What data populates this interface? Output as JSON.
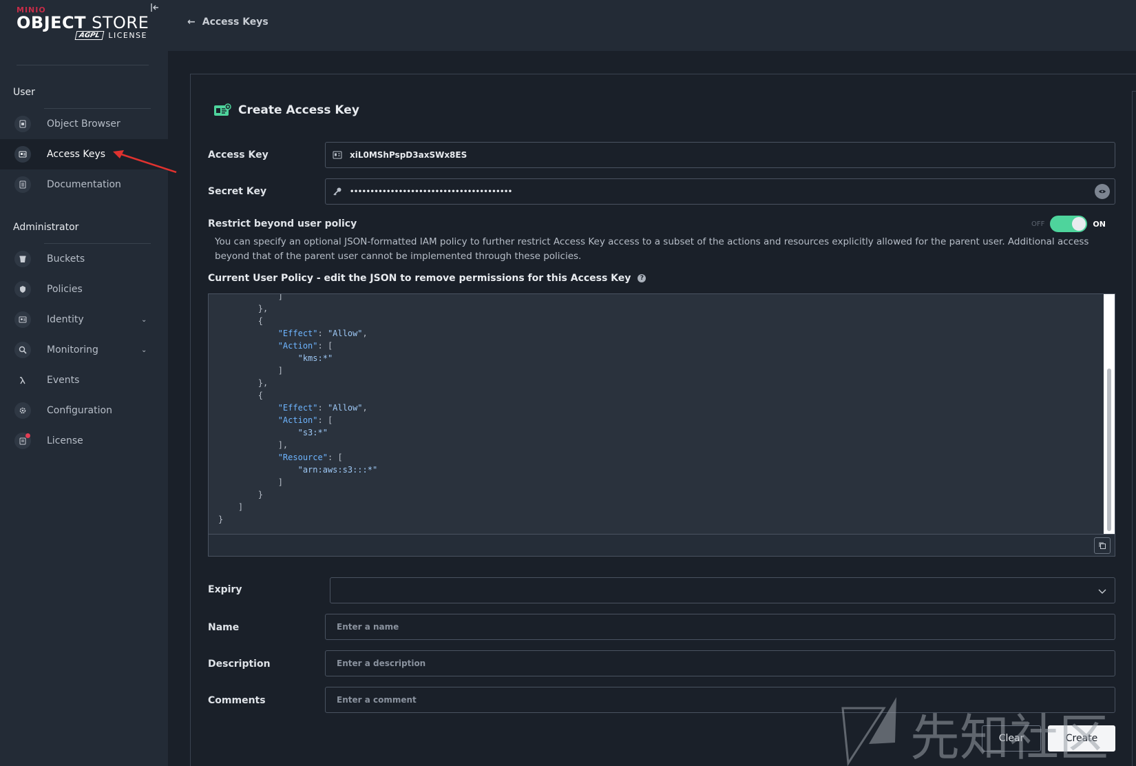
{
  "sidebar": {
    "logo": {
      "brand": "MINIO",
      "product_bold": "OBJECT",
      "product_rest": " STORE",
      "agpl": "AGPL",
      "license": "LICENSE"
    },
    "sections": [
      {
        "title": "User"
      },
      {
        "title": "Administrator"
      }
    ],
    "items": [
      {
        "label": "Object Browser",
        "icon": "object-browser-icon"
      },
      {
        "label": "Access Keys",
        "icon": "access-keys-icon",
        "active": true
      },
      {
        "label": "Documentation",
        "icon": "documentation-icon"
      },
      {
        "label": "Buckets",
        "icon": "buckets-icon"
      },
      {
        "label": "Policies",
        "icon": "policies-icon"
      },
      {
        "label": "Identity",
        "icon": "identity-icon",
        "expandable": true
      },
      {
        "label": "Monitoring",
        "icon": "monitoring-icon",
        "expandable": true
      },
      {
        "label": "Events",
        "icon": "lambda-icon"
      },
      {
        "label": "Configuration",
        "icon": "gear-icon"
      },
      {
        "label": "License",
        "icon": "license-icon"
      }
    ]
  },
  "topbar": {
    "back_label": "Access Keys"
  },
  "form": {
    "title": "Create Access Key",
    "access_key": {
      "label": "Access Key",
      "value": "xiL0MShPspD3axSWx8ES"
    },
    "secret_key": {
      "label": "Secret Key",
      "value": "••••••••••••••••••••••••••••••••••••••••"
    },
    "restrict": {
      "label": "Restrict beyond user policy",
      "off_label": "OFF",
      "on_label": "ON",
      "enabled": true,
      "help": "You can specify an optional JSON-formatted IAM policy to further restrict Access Key access to a subset of the actions and resources explicitly allowed for the parent user. Additional access beyond that of the parent user cannot be implemented through these policies."
    },
    "policy_label": "Current User Policy - edit the JSON to remove permissions for this Access Key",
    "expiry": {
      "label": "Expiry",
      "value": ""
    },
    "name": {
      "label": "Name",
      "placeholder": "Enter a name"
    },
    "description": {
      "label": "Description",
      "placeholder": "Enter a description"
    },
    "comments": {
      "label": "Comments",
      "placeholder": "Enter a comment"
    },
    "clear_label": "Clear",
    "create_label": "Create"
  },
  "watermark": {
    "text": "先知社区"
  },
  "colors": {
    "accent": "#4ed49c",
    "brand_red": "#c72c48",
    "sidebar_bg": "#232b36",
    "main_bg": "#1a2029"
  }
}
